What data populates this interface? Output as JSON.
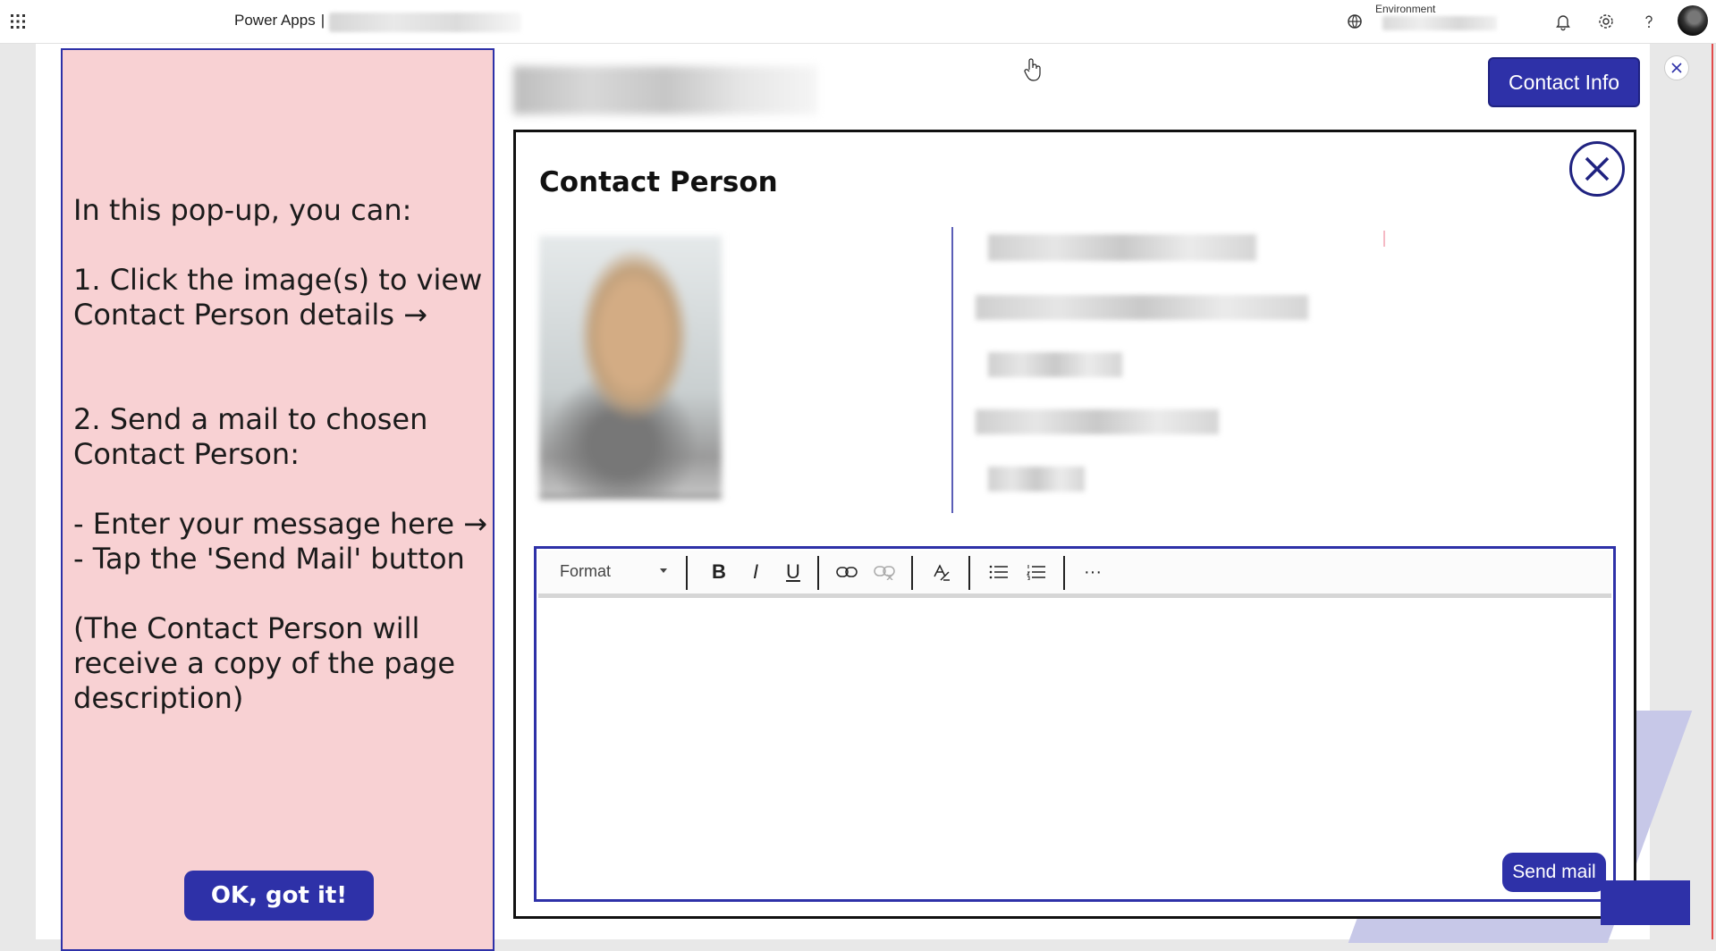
{
  "topbar": {
    "brand": "Power Apps",
    "separator": "|",
    "environment_label": "Environment"
  },
  "help": {
    "text": "In this pop-up, you can:\n\n1. Click the image(s) to view Contact Person details →\n\n\n2. Send a mail to chosen Contact Person:\n\n- Enter your message here →\n- Tap the 'Send Mail' button\n\n(The Contact Person will receive a copy of the page description)",
    "ok_label": "OK, got it!"
  },
  "header": {
    "contact_info_label": "Contact Info"
  },
  "popup": {
    "title": "Contact Person",
    "editor": {
      "format_label": "Format",
      "bold": "B",
      "italic": "I",
      "underline": "U",
      "more": "···"
    },
    "send_label": "Send mail"
  },
  "colors": {
    "accent": "#2e31a8",
    "help_bg": "#f8d1d3",
    "deco": "#c7c8e8"
  },
  "icons": [
    "waffle-icon",
    "environment-icon",
    "bell-icon",
    "gear-icon",
    "help-icon",
    "close-icon",
    "link-icon",
    "unlink-icon",
    "clear-format-icon",
    "bullet-list-icon",
    "numbered-list-icon"
  ]
}
